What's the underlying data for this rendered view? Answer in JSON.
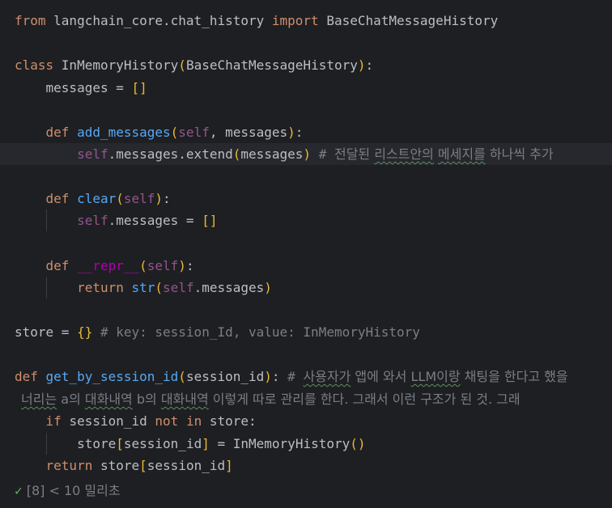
{
  "code": {
    "l1": {
      "kw1": "from",
      "mod": " langchain_core.chat_history ",
      "kw2": "import",
      "cls": " BaseChatMessageHistory"
    },
    "l3": {
      "kw": "class ",
      "name": "InMemoryHistory",
      "p1": "(",
      "base": "BaseChatMessageHistory",
      "p2": ")",
      "colon": ":"
    },
    "l4": {
      "indent": "    ",
      "var": "messages = ",
      "val": "[]"
    },
    "l6": {
      "indent": "    ",
      "kw": "def ",
      "name": "add_messages",
      "p1": "(",
      "self": "self",
      "rest": ", messages",
      "p2": ")",
      "colon": ":"
    },
    "l7": {
      "indent": "        ",
      "self": "self",
      "body": ".messages.extend",
      "p1": "(",
      "arg": "messages",
      "p2": ")",
      "cm_hash": " # ",
      "cm1": "전달된 ",
      "cm2": "리스트안의",
      "cm3": " ",
      "cm4": "메세지를",
      "cm5": " 하나씩 추가"
    },
    "l9": {
      "indent": "    ",
      "kw": "def ",
      "name": "clear",
      "p1": "(",
      "self": "self",
      "p2": ")",
      "colon": ":"
    },
    "l10": {
      "indent": "        ",
      "self": "self",
      "body": ".messages = ",
      "val": "[]"
    },
    "l12": {
      "indent": "    ",
      "kw": "def ",
      "name": "__repr__",
      "p1": "(",
      "self": "self",
      "p2": ")",
      "colon": ":"
    },
    "l13": {
      "indent": "        ",
      "kw": "return ",
      "fn": "str",
      "p1": "(",
      "self": "self",
      "body": ".messages",
      "p2": ")"
    },
    "l15": {
      "var": "store = ",
      "val": "{}",
      "cm": " # key: session_Id, value: InMemoryHistory"
    },
    "l17": {
      "kw": "def ",
      "name": "get_by_session_id",
      "p1": "(",
      "arg": "session_id",
      "p2": ")",
      "colon": ":",
      "cm_hash": " # ",
      "cm1": "사용자가",
      "cm2": " 앱에 와서 ",
      "cm3": "LLM이랑",
      "cm4": " 채팅을 한다고 했을"
    },
    "l17b": {
      "cm1": "너리는",
      "cm2": " a의 ",
      "cm3": "대화내역",
      "cm4": " b의 ",
      "cm5": "대화내역",
      "cm6": " 이렇게 따로 관리를 한다. 그래서 이런 구조가 된 것. 그래"
    },
    "l18": {
      "indent": "    ",
      "kw1": "if ",
      "var": "session_id ",
      "kw2": "not in ",
      "rest": "store:"
    },
    "l19": {
      "indent": "        ",
      "var": "store",
      "b1": "[",
      "key": "session_id",
      "b2": "]",
      "eq": " = ",
      "fn": "InMemoryHistory",
      "p": "()"
    },
    "l20": {
      "indent": "    ",
      "kw": "return ",
      "var": "store",
      "b1": "[",
      "key": "session_id",
      "b2": "]"
    }
  },
  "footer": {
    "check": "✓",
    "text": " [8] < 10 밀리초"
  },
  "colors": {
    "keyword": "#cf8e6d",
    "function": "#56a8f5",
    "self": "#94558d",
    "dunder": "#b200b2",
    "comment": "#7a7e85",
    "bracket": "#e8ba36",
    "background": "#1e1f22"
  }
}
